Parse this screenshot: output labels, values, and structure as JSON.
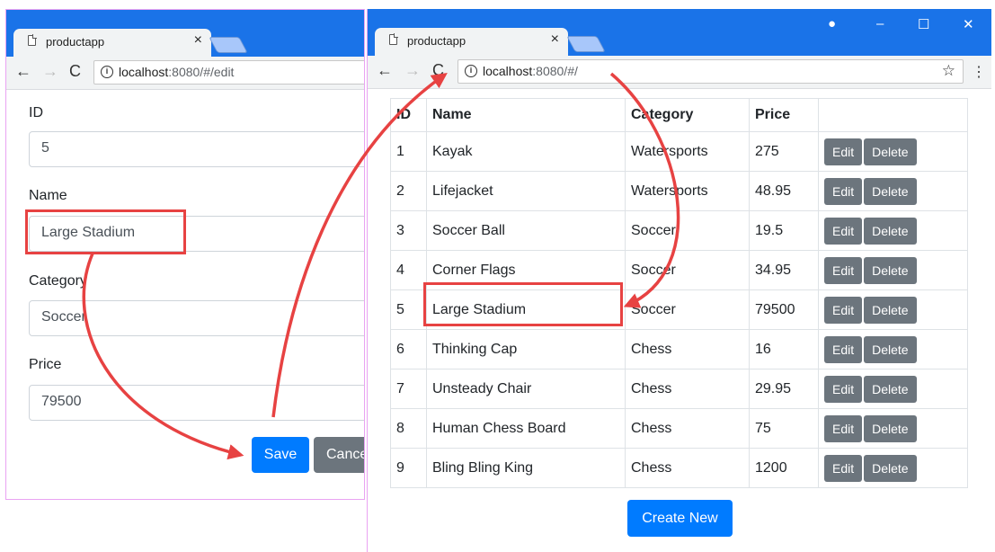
{
  "left_window": {
    "tab": {
      "title": "productapp",
      "close": "×"
    },
    "url": {
      "host": "localhost",
      "path": ":8080/#/edit"
    },
    "form": {
      "id_label": "ID",
      "id_value": "5",
      "name_label": "Name",
      "name_value": "Large Stadium",
      "category_label": "Category",
      "category_value": "Soccer",
      "price_label": "Price",
      "price_value": "79500"
    },
    "save_label": "Save",
    "cancel_label": "Cancel"
  },
  "right_window": {
    "tab": {
      "title": "productapp",
      "close": "×"
    },
    "url": {
      "host": "localhost",
      "path": ":8080/#/"
    },
    "window_controls": {
      "account": "●",
      "minimize": "–",
      "maximize": "☐",
      "close": "✕"
    },
    "table": {
      "headers": [
        "ID",
        "Name",
        "Category",
        "Price",
        ""
      ],
      "rows": [
        [
          "1",
          "Kayak",
          "Watersports",
          "275"
        ],
        [
          "2",
          "Lifejacket",
          "Watersports",
          "48.95"
        ],
        [
          "3",
          "Soccer Ball",
          "Soccer",
          "19.5"
        ],
        [
          "4",
          "Corner Flags",
          "Soccer",
          "34.95"
        ],
        [
          "5",
          "Large Stadium",
          "Soccer",
          "79500"
        ],
        [
          "6",
          "Thinking Cap",
          "Chess",
          "16"
        ],
        [
          "7",
          "Unsteady Chair",
          "Chess",
          "29.95"
        ],
        [
          "8",
          "Human Chess Board",
          "Chess",
          "75"
        ],
        [
          "9",
          "Bling Bling King",
          "Chess",
          "1200"
        ]
      ],
      "edit_label": "Edit",
      "delete_label": "Delete"
    },
    "create_label": "Create New"
  },
  "colors": {
    "titlebar": "#1a73e8",
    "primary": "#007bff",
    "secondary": "#6c757d",
    "highlight": "#e74242",
    "window_border": "#e9a3f2"
  },
  "icons": [
    "page-icon",
    "back-arrow-icon",
    "forward-arrow-icon",
    "reload-icon",
    "info-icon",
    "star-icon",
    "menu-dots-icon"
  ]
}
